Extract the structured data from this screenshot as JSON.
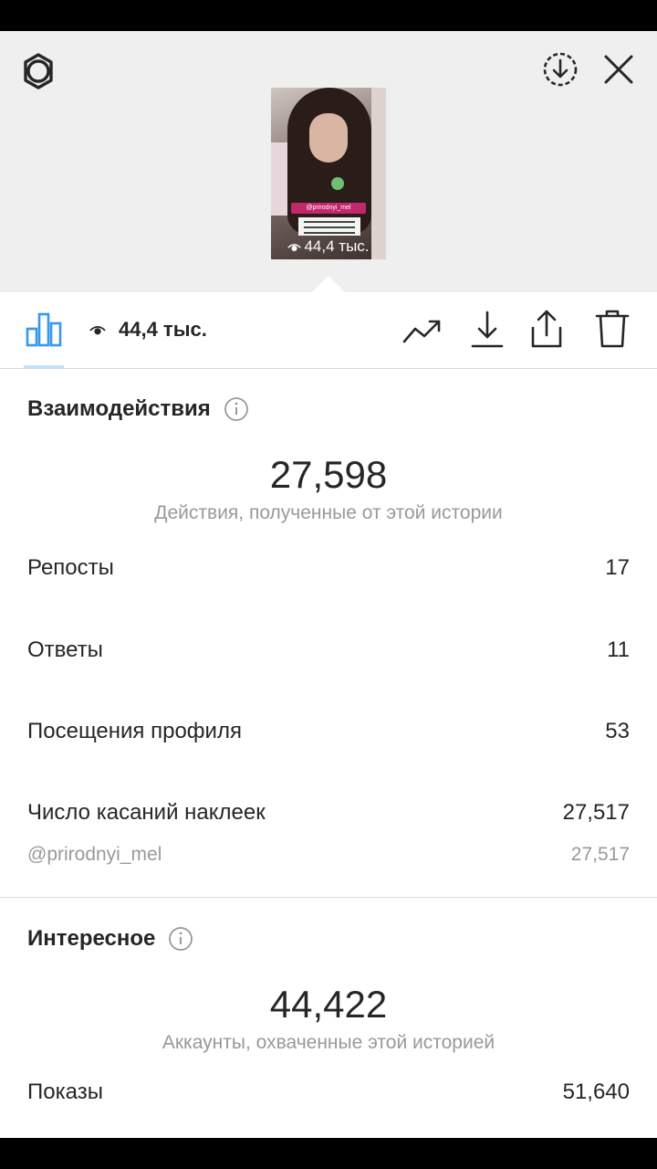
{
  "story": {
    "thumb_tag": "@prirodnyi_mel",
    "thumb_views": "44,4 тыс."
  },
  "stats_bar": {
    "views": "44,4 тыс."
  },
  "interactions": {
    "title": "Взаимодействия",
    "total": "27,598",
    "caption": "Действия, полученные от этой истории",
    "rows": [
      {
        "label": "Репосты",
        "value": "17"
      },
      {
        "label": "Ответы",
        "value": "11"
      },
      {
        "label": "Посещения профиля",
        "value": "53"
      },
      {
        "label": "Число касаний наклеек",
        "value": "27,517"
      }
    ],
    "sticker": {
      "label": "@prirodnyi_mel",
      "value": "27,517"
    }
  },
  "discovery": {
    "title": "Интересное",
    "total": "44,422",
    "caption": "Аккаунты, охваченные этой историей",
    "rows": [
      {
        "label": "Показы",
        "value": "51,640"
      }
    ]
  },
  "icons": {
    "settings": "settings-icon",
    "save": "download-circle-icon",
    "close": "close-icon",
    "insights": "bar-chart-icon",
    "views": "eye-icon",
    "promote": "trending-up-icon",
    "download": "download-icon",
    "share": "share-icon",
    "delete": "trash-icon",
    "info": "info-icon"
  },
  "colors": {
    "accent": "#3897f0",
    "text": "#262626",
    "muted": "#999999",
    "header_bg": "#efefef",
    "tag": "#c2286b"
  }
}
